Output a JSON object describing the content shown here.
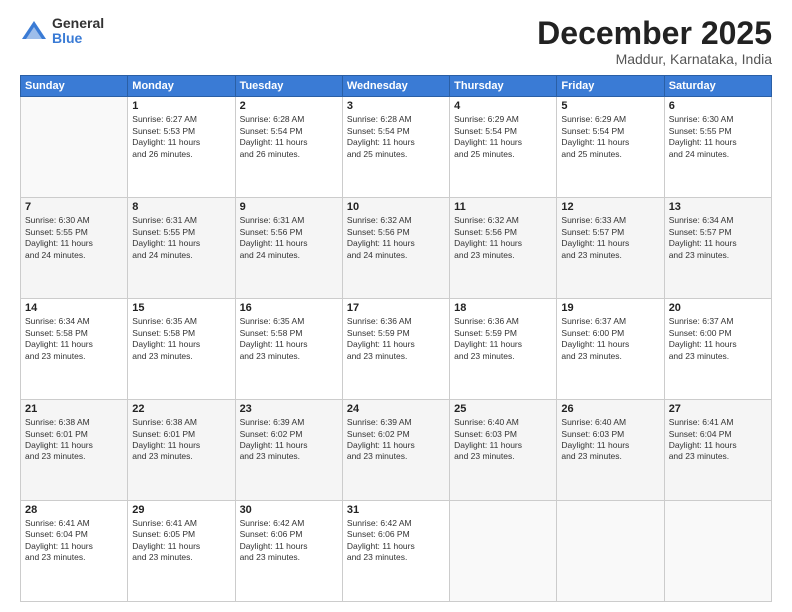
{
  "logo": {
    "general": "General",
    "blue": "Blue"
  },
  "header": {
    "month": "December 2025",
    "location": "Maddur, Karnataka, India"
  },
  "weekdays": [
    "Sunday",
    "Monday",
    "Tuesday",
    "Wednesday",
    "Thursday",
    "Friday",
    "Saturday"
  ],
  "weeks": [
    [
      {
        "day": "",
        "info": ""
      },
      {
        "day": "1",
        "info": "Sunrise: 6:27 AM\nSunset: 5:53 PM\nDaylight: 11 hours\nand 26 minutes."
      },
      {
        "day": "2",
        "info": "Sunrise: 6:28 AM\nSunset: 5:54 PM\nDaylight: 11 hours\nand 26 minutes."
      },
      {
        "day": "3",
        "info": "Sunrise: 6:28 AM\nSunset: 5:54 PM\nDaylight: 11 hours\nand 25 minutes."
      },
      {
        "day": "4",
        "info": "Sunrise: 6:29 AM\nSunset: 5:54 PM\nDaylight: 11 hours\nand 25 minutes."
      },
      {
        "day": "5",
        "info": "Sunrise: 6:29 AM\nSunset: 5:54 PM\nDaylight: 11 hours\nand 25 minutes."
      },
      {
        "day": "6",
        "info": "Sunrise: 6:30 AM\nSunset: 5:55 PM\nDaylight: 11 hours\nand 24 minutes."
      }
    ],
    [
      {
        "day": "7",
        "info": "Sunrise: 6:30 AM\nSunset: 5:55 PM\nDaylight: 11 hours\nand 24 minutes."
      },
      {
        "day": "8",
        "info": "Sunrise: 6:31 AM\nSunset: 5:55 PM\nDaylight: 11 hours\nand 24 minutes."
      },
      {
        "day": "9",
        "info": "Sunrise: 6:31 AM\nSunset: 5:56 PM\nDaylight: 11 hours\nand 24 minutes."
      },
      {
        "day": "10",
        "info": "Sunrise: 6:32 AM\nSunset: 5:56 PM\nDaylight: 11 hours\nand 24 minutes."
      },
      {
        "day": "11",
        "info": "Sunrise: 6:32 AM\nSunset: 5:56 PM\nDaylight: 11 hours\nand 23 minutes."
      },
      {
        "day": "12",
        "info": "Sunrise: 6:33 AM\nSunset: 5:57 PM\nDaylight: 11 hours\nand 23 minutes."
      },
      {
        "day": "13",
        "info": "Sunrise: 6:34 AM\nSunset: 5:57 PM\nDaylight: 11 hours\nand 23 minutes."
      }
    ],
    [
      {
        "day": "14",
        "info": "Sunrise: 6:34 AM\nSunset: 5:58 PM\nDaylight: 11 hours\nand 23 minutes."
      },
      {
        "day": "15",
        "info": "Sunrise: 6:35 AM\nSunset: 5:58 PM\nDaylight: 11 hours\nand 23 minutes."
      },
      {
        "day": "16",
        "info": "Sunrise: 6:35 AM\nSunset: 5:58 PM\nDaylight: 11 hours\nand 23 minutes."
      },
      {
        "day": "17",
        "info": "Sunrise: 6:36 AM\nSunset: 5:59 PM\nDaylight: 11 hours\nand 23 minutes."
      },
      {
        "day": "18",
        "info": "Sunrise: 6:36 AM\nSunset: 5:59 PM\nDaylight: 11 hours\nand 23 minutes."
      },
      {
        "day": "19",
        "info": "Sunrise: 6:37 AM\nSunset: 6:00 PM\nDaylight: 11 hours\nand 23 minutes."
      },
      {
        "day": "20",
        "info": "Sunrise: 6:37 AM\nSunset: 6:00 PM\nDaylight: 11 hours\nand 23 minutes."
      }
    ],
    [
      {
        "day": "21",
        "info": "Sunrise: 6:38 AM\nSunset: 6:01 PM\nDaylight: 11 hours\nand 23 minutes."
      },
      {
        "day": "22",
        "info": "Sunrise: 6:38 AM\nSunset: 6:01 PM\nDaylight: 11 hours\nand 23 minutes."
      },
      {
        "day": "23",
        "info": "Sunrise: 6:39 AM\nSunset: 6:02 PM\nDaylight: 11 hours\nand 23 minutes."
      },
      {
        "day": "24",
        "info": "Sunrise: 6:39 AM\nSunset: 6:02 PM\nDaylight: 11 hours\nand 23 minutes."
      },
      {
        "day": "25",
        "info": "Sunrise: 6:40 AM\nSunset: 6:03 PM\nDaylight: 11 hours\nand 23 minutes."
      },
      {
        "day": "26",
        "info": "Sunrise: 6:40 AM\nSunset: 6:03 PM\nDaylight: 11 hours\nand 23 minutes."
      },
      {
        "day": "27",
        "info": "Sunrise: 6:41 AM\nSunset: 6:04 PM\nDaylight: 11 hours\nand 23 minutes."
      }
    ],
    [
      {
        "day": "28",
        "info": "Sunrise: 6:41 AM\nSunset: 6:04 PM\nDaylight: 11 hours\nand 23 minutes."
      },
      {
        "day": "29",
        "info": "Sunrise: 6:41 AM\nSunset: 6:05 PM\nDaylight: 11 hours\nand 23 minutes."
      },
      {
        "day": "30",
        "info": "Sunrise: 6:42 AM\nSunset: 6:06 PM\nDaylight: 11 hours\nand 23 minutes."
      },
      {
        "day": "31",
        "info": "Sunrise: 6:42 AM\nSunset: 6:06 PM\nDaylight: 11 hours\nand 23 minutes."
      },
      {
        "day": "",
        "info": ""
      },
      {
        "day": "",
        "info": ""
      },
      {
        "day": "",
        "info": ""
      }
    ]
  ]
}
